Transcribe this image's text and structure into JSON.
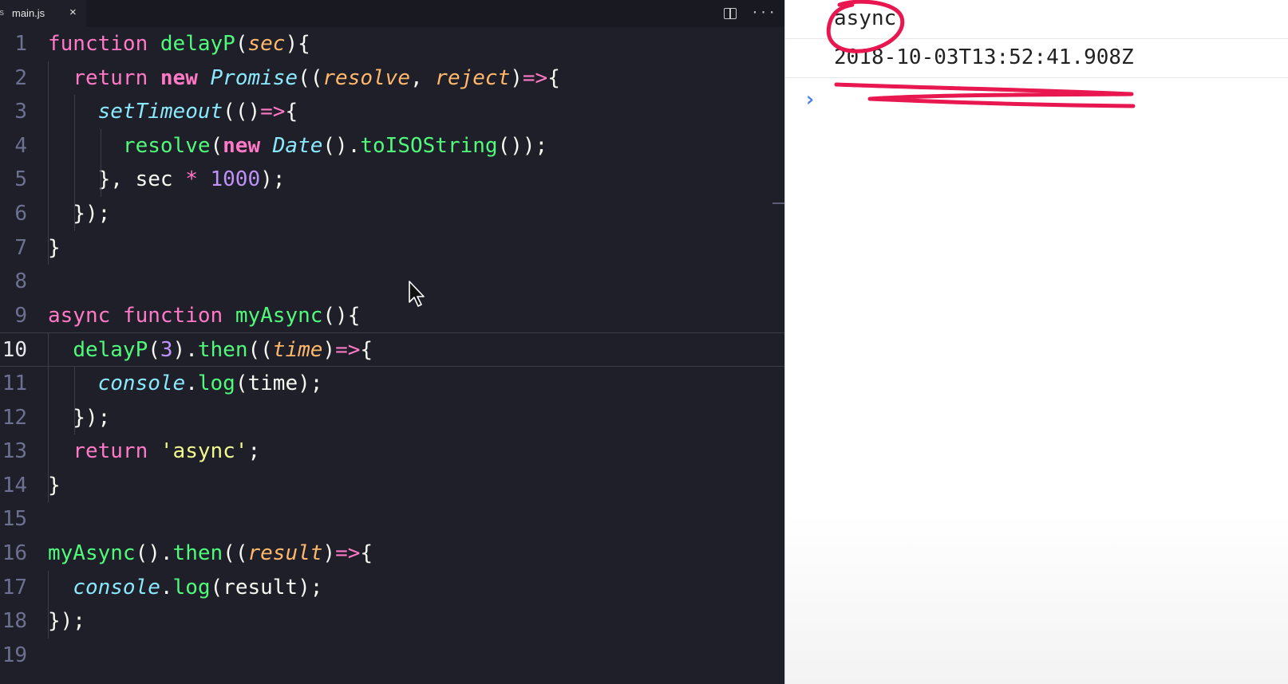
{
  "editor": {
    "tab": {
      "label": "main.js",
      "file_icon": "js",
      "close": "×"
    },
    "actions": {
      "more": "···"
    },
    "active_line": 10,
    "lines": [
      {
        "n": "1",
        "tokens": [
          [
            "t-kw",
            "function"
          ],
          [
            "t-plain",
            " "
          ],
          [
            "t-fn",
            "delayP"
          ],
          [
            "t-plain",
            "("
          ],
          [
            "t-param",
            "sec"
          ],
          [
            "t-plain",
            "){"
          ]
        ]
      },
      {
        "n": "2",
        "tokens": [
          [
            "t-plain",
            "  "
          ],
          [
            "t-kw",
            "return"
          ],
          [
            "t-plain",
            " "
          ],
          [
            "t-kwb",
            "new"
          ],
          [
            "t-plain",
            " "
          ],
          [
            "t-cls",
            "Promise"
          ],
          [
            "t-plain",
            "(("
          ],
          [
            "t-param",
            "resolve"
          ],
          [
            "t-plain",
            ", "
          ],
          [
            "t-param",
            "reject"
          ],
          [
            "t-plain",
            ")"
          ],
          [
            "t-op",
            "=>"
          ],
          [
            "t-plain",
            "{"
          ]
        ]
      },
      {
        "n": "3",
        "tokens": [
          [
            "t-plain",
            "    "
          ],
          [
            "t-cls",
            "setTimeout"
          ],
          [
            "t-plain",
            "(()"
          ],
          [
            "t-op",
            "=>"
          ],
          [
            "t-plain",
            "{"
          ]
        ]
      },
      {
        "n": "4",
        "tokens": [
          [
            "t-plain",
            "      "
          ],
          [
            "t-fn",
            "resolve"
          ],
          [
            "t-plain",
            "("
          ],
          [
            "t-kwb",
            "new"
          ],
          [
            "t-plain",
            " "
          ],
          [
            "t-cls",
            "Date"
          ],
          [
            "t-plain",
            "()."
          ],
          [
            "t-fn",
            "toISOString"
          ],
          [
            "t-plain",
            "());"
          ]
        ]
      },
      {
        "n": "5",
        "tokens": [
          [
            "t-plain",
            "    }, sec "
          ],
          [
            "t-op",
            "*"
          ],
          [
            "t-plain",
            " "
          ],
          [
            "t-num",
            "1000"
          ],
          [
            "t-plain",
            ");"
          ]
        ]
      },
      {
        "n": "6",
        "tokens": [
          [
            "t-plain",
            "  });"
          ]
        ]
      },
      {
        "n": "7",
        "tokens": [
          [
            "t-plain",
            "}"
          ]
        ]
      },
      {
        "n": "8",
        "tokens": []
      },
      {
        "n": "9",
        "tokens": [
          [
            "t-kw",
            "async"
          ],
          [
            "t-plain",
            " "
          ],
          [
            "t-kw",
            "function"
          ],
          [
            "t-plain",
            " "
          ],
          [
            "t-fn",
            "myAsync"
          ],
          [
            "t-plain",
            "(){"
          ]
        ]
      },
      {
        "n": "10",
        "tokens": [
          [
            "t-plain",
            "  "
          ],
          [
            "t-fn",
            "delayP"
          ],
          [
            "t-plain",
            "("
          ],
          [
            "t-num",
            "3"
          ],
          [
            "t-plain",
            ")."
          ],
          [
            "t-fn",
            "then"
          ],
          [
            "t-plain",
            "(("
          ],
          [
            "t-param",
            "time"
          ],
          [
            "t-plain",
            ")"
          ],
          [
            "t-op",
            "=>"
          ],
          [
            "t-plain",
            "{"
          ]
        ]
      },
      {
        "n": "11",
        "tokens": [
          [
            "t-plain",
            "    "
          ],
          [
            "t-cls",
            "console"
          ],
          [
            "t-plain",
            "."
          ],
          [
            "t-fn",
            "log"
          ],
          [
            "t-plain",
            "(time);"
          ]
        ]
      },
      {
        "n": "12",
        "tokens": [
          [
            "t-plain",
            "  });"
          ]
        ]
      },
      {
        "n": "13",
        "tokens": [
          [
            "t-plain",
            "  "
          ],
          [
            "t-kw",
            "return"
          ],
          [
            "t-plain",
            " "
          ],
          [
            "t-str",
            "'async'"
          ],
          [
            "t-plain",
            ";"
          ]
        ]
      },
      {
        "n": "14",
        "tokens": [
          [
            "t-plain",
            "}"
          ]
        ]
      },
      {
        "n": "15",
        "tokens": []
      },
      {
        "n": "16",
        "tokens": [
          [
            "t-fn",
            "myAsync"
          ],
          [
            "t-plain",
            "()."
          ],
          [
            "t-fn",
            "then"
          ],
          [
            "t-plain",
            "(("
          ],
          [
            "t-param",
            "result"
          ],
          [
            "t-plain",
            ")"
          ],
          [
            "t-op",
            "=>"
          ],
          [
            "t-plain",
            "{"
          ]
        ]
      },
      {
        "n": "17",
        "tokens": [
          [
            "t-plain",
            "  "
          ],
          [
            "t-cls",
            "console"
          ],
          [
            "t-plain",
            "."
          ],
          [
            "t-fn",
            "log"
          ],
          [
            "t-plain",
            "(result);"
          ]
        ]
      },
      {
        "n": "18",
        "tokens": [
          [
            "t-plain",
            "});"
          ]
        ]
      },
      {
        "n": "19",
        "tokens": []
      }
    ]
  },
  "console": {
    "entries": [
      "async",
      "2018-10-03T13:52:41.908Z"
    ],
    "prompt": "›"
  },
  "colors": {
    "editor_bg": "#1e1f28",
    "keyword": "#ff79c6",
    "function": "#50fa7b",
    "class": "#8be9fd",
    "param": "#ffb86c",
    "number": "#bd93f9",
    "string": "#f1fa8c",
    "annotation": "#e8174f",
    "prompt": "#4a7cf0"
  }
}
